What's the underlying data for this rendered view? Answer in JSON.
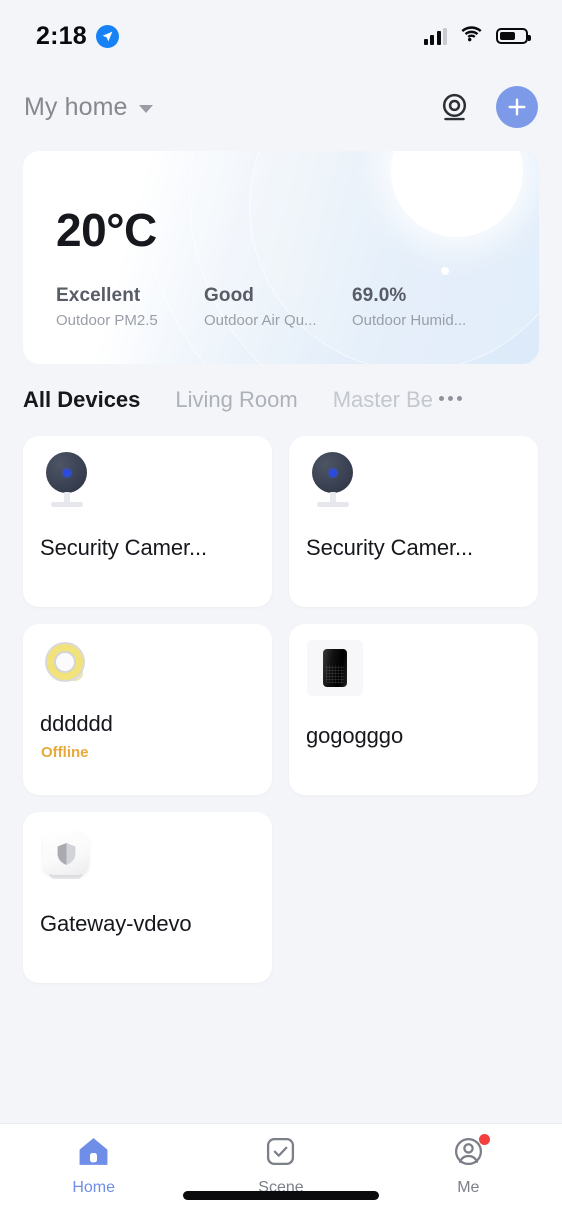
{
  "status_bar": {
    "time": "2:18",
    "location_icon": "location-arrow-icon",
    "signal_icon": "cellular-signal-icon",
    "wifi_icon": "wifi-icon",
    "battery_icon": "battery-icon",
    "battery_level": "62%"
  },
  "header": {
    "home_name": "My home",
    "dropdown_icon": "chevron-down-icon",
    "camera_icon": "camera-monitor-icon",
    "add_icon": "plus-icon",
    "accent_color": "#7d9ae9"
  },
  "weather": {
    "temperature": "20°C",
    "stats": [
      {
        "value": "Excellent",
        "label": "Outdoor PM2.5"
      },
      {
        "value": "Good",
        "label": "Outdoor Air Qu..."
      },
      {
        "value": "69.0%",
        "label": "Outdoor Humid..."
      }
    ]
  },
  "tabs": {
    "items": [
      {
        "label": "All Devices",
        "active": true
      },
      {
        "label": "Living Room",
        "active": false
      },
      {
        "label": "Master Be",
        "active": false
      }
    ],
    "more_icon": "more-dots-icon"
  },
  "devices": [
    {
      "name": "Security Camer...",
      "icon": "security-camera-icon",
      "status": ""
    },
    {
      "name": "Security Camer...",
      "icon": "security-camera-icon",
      "status": ""
    },
    {
      "name": "dddddd",
      "icon": "light-strip-reel-icon",
      "status": "Offline"
    },
    {
      "name": "gogogggo",
      "icon": "speaker-icon",
      "status": ""
    },
    {
      "name": "Gateway-vdevo",
      "icon": "gateway-shield-icon",
      "status": ""
    }
  ],
  "bottom_nav": {
    "items": [
      {
        "label": "Home",
        "icon": "home-icon",
        "active": true,
        "badge": false
      },
      {
        "label": "Scene",
        "icon": "checkbox-scene-icon",
        "active": false,
        "badge": false
      },
      {
        "label": "Me",
        "icon": "profile-avatar-icon",
        "active": false,
        "badge": true
      }
    ]
  },
  "colors": {
    "offline_status": "#e8a93a",
    "nav_active": "#6f8ee8",
    "badge": "#f43f3f",
    "background": "#f4f5f9"
  }
}
